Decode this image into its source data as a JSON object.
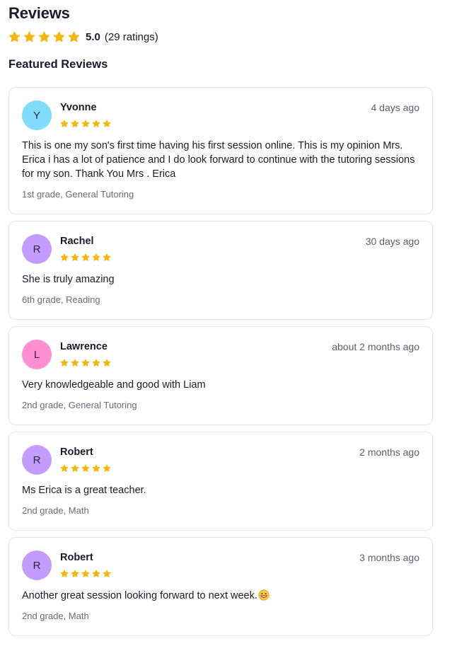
{
  "header": {
    "title": "Reviews",
    "rating_value": "5.0",
    "rating_count": "(29 ratings)",
    "rating_stars": 5,
    "featured_title": "Featured Reviews"
  },
  "colors": {
    "star": "#f5b50a",
    "text": "#1b1b2e",
    "muted": "#6a6a80",
    "border": "#e4e4ea"
  },
  "reviews": [
    {
      "initial": "Y",
      "avatar_color": "#7fdcfb",
      "name": "Yvonne",
      "date": "4 days ago",
      "stars": 5,
      "text": "This is one my son's first time having his first session online. This is my opinion Mrs. Erica i has a lot of patience and I do look forward to continue with the tutoring sessions for my son. Thank You Mrs . Erica",
      "meta": "1st grade, General Tutoring"
    },
    {
      "initial": "R",
      "avatar_color": "#c49bff",
      "name": "Rachel",
      "date": "30 days ago",
      "stars": 5,
      "text": "She is truly amazing",
      "meta": "6th grade, Reading"
    },
    {
      "initial": "L",
      "avatar_color": "#ff8fd2",
      "name": "Lawrence",
      "date": "about 2 months ago",
      "stars": 5,
      "text": "Very knowledgeable and good with Liam",
      "meta": "2nd grade, General Tutoring"
    },
    {
      "initial": "R",
      "avatar_color": "#c49bff",
      "name": "Robert",
      "date": "2 months ago",
      "stars": 5,
      "text": "Ms Erica is a great teacher.",
      "meta": "2nd grade, Math"
    },
    {
      "initial": "R",
      "avatar_color": "#c49bff",
      "name": "Robert",
      "date": "3 months ago",
      "stars": 5,
      "text": "Another great session looking forward to next week.",
      "emoji": "grinning-face-emoji",
      "meta": "2nd grade, Math"
    }
  ]
}
